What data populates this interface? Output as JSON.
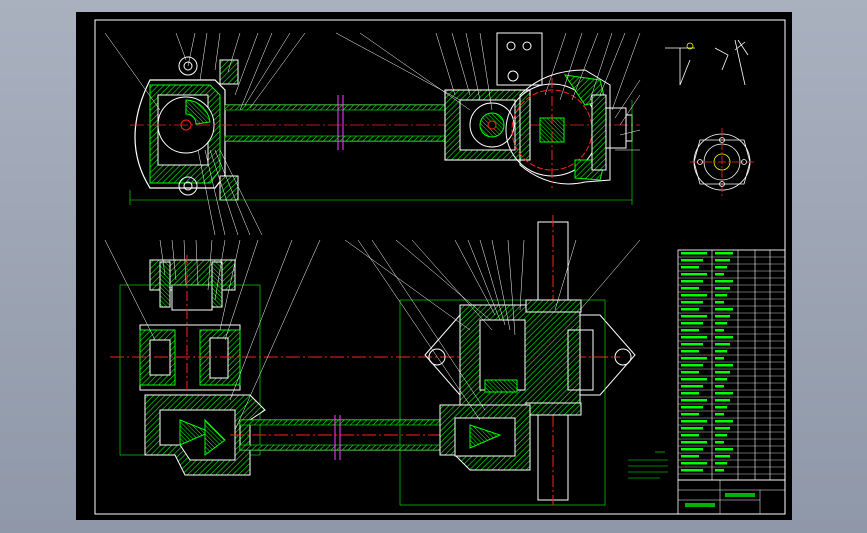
{
  "drawing": {
    "title_block_labels": [],
    "notes_heading": "",
    "colors": {
      "background": "#000000",
      "outline": "#ffffff",
      "hatch": "#00ff00",
      "center_line": "#ff2020",
      "dimension": "#00ff00",
      "leader": "#ffffff",
      "accent": "#ff40ff",
      "yellow": "#ffff00"
    }
  }
}
